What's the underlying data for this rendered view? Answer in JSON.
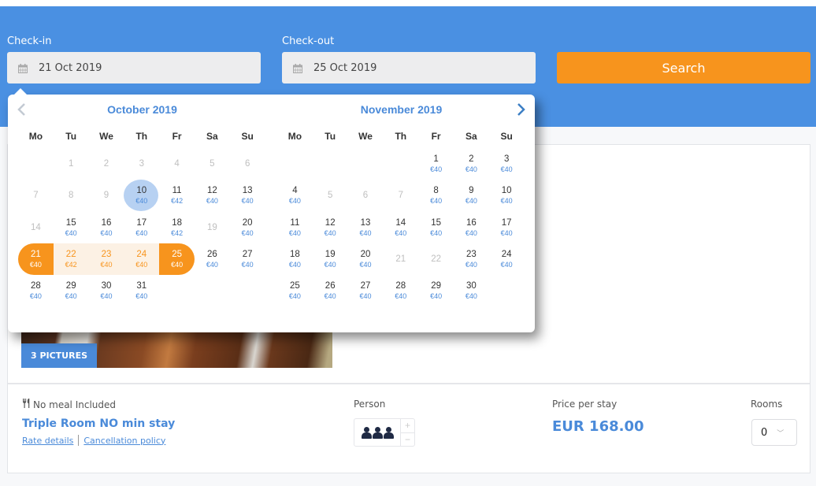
{
  "search": {
    "checkin_label": "Check-in",
    "checkout_label": "Check-out",
    "checkin_value": "21 Oct 2019",
    "checkout_value": "25 Oct 2019",
    "search_label": "Search"
  },
  "datepicker": {
    "prev_icon": "‹",
    "next_icon": "›",
    "weekdays": [
      "Mo",
      "Tu",
      "We",
      "Th",
      "Fr",
      "Sa",
      "Su"
    ],
    "months": [
      {
        "title": "October 2019",
        "offset": 1,
        "days": [
          {
            "d": "1",
            "state": "disabled"
          },
          {
            "d": "2",
            "state": "disabled"
          },
          {
            "d": "3",
            "state": "disabled"
          },
          {
            "d": "4",
            "state": "disabled"
          },
          {
            "d": "5",
            "state": "disabled"
          },
          {
            "d": "6",
            "state": "disabled"
          },
          {
            "d": "7",
            "state": "disabled"
          },
          {
            "d": "8",
            "state": "disabled"
          },
          {
            "d": "9",
            "state": "disabled"
          },
          {
            "d": "10",
            "p": "€40",
            "state": "hover"
          },
          {
            "d": "11",
            "p": "€42"
          },
          {
            "d": "12",
            "p": "€40"
          },
          {
            "d": "13",
            "p": "€40"
          },
          {
            "d": "14",
            "state": "disabled"
          },
          {
            "d": "15",
            "p": "€40"
          },
          {
            "d": "16",
            "p": "€40"
          },
          {
            "d": "17",
            "p": "€40"
          },
          {
            "d": "18",
            "p": "€42"
          },
          {
            "d": "19",
            "state": "disabled"
          },
          {
            "d": "20",
            "p": "€40"
          },
          {
            "d": "21",
            "p": "€40",
            "state": "range-start"
          },
          {
            "d": "22",
            "p": "€42",
            "state": "in-range"
          },
          {
            "d": "23",
            "p": "€40",
            "state": "in-range"
          },
          {
            "d": "24",
            "p": "€40",
            "state": "in-range"
          },
          {
            "d": "25",
            "p": "€40",
            "state": "range-end"
          },
          {
            "d": "26",
            "p": "€40"
          },
          {
            "d": "27",
            "p": "€40"
          },
          {
            "d": "28",
            "p": "€40"
          },
          {
            "d": "29",
            "p": "€40"
          },
          {
            "d": "30",
            "p": "€40"
          },
          {
            "d": "31",
            "p": "€40"
          }
        ]
      },
      {
        "title": "November 2019",
        "offset": 4,
        "days": [
          {
            "d": "1",
            "p": "€40"
          },
          {
            "d": "2",
            "p": "€40"
          },
          {
            "d": "3",
            "p": "€40"
          },
          {
            "d": "4",
            "p": "€40"
          },
          {
            "d": "5",
            "state": "disabled"
          },
          {
            "d": "6",
            "state": "disabled"
          },
          {
            "d": "7",
            "state": "disabled"
          },
          {
            "d": "8",
            "p": "€40"
          },
          {
            "d": "9",
            "p": "€40"
          },
          {
            "d": "10",
            "p": "€40"
          },
          {
            "d": "11",
            "p": "€40"
          },
          {
            "d": "12",
            "p": "€40"
          },
          {
            "d": "13",
            "p": "€40"
          },
          {
            "d": "14",
            "p": "€40"
          },
          {
            "d": "15",
            "p": "€40"
          },
          {
            "d": "16",
            "p": "€40"
          },
          {
            "d": "17",
            "p": "€40"
          },
          {
            "d": "18",
            "p": "€40"
          },
          {
            "d": "19",
            "p": "€40"
          },
          {
            "d": "20",
            "p": "€40"
          },
          {
            "d": "21",
            "state": "disabled"
          },
          {
            "d": "22",
            "state": "disabled"
          },
          {
            "d": "23",
            "p": "€40"
          },
          {
            "d": "24",
            "p": "€40"
          },
          {
            "d": "25",
            "p": "€40"
          },
          {
            "d": "26",
            "p": "€40"
          },
          {
            "d": "27",
            "p": "€40"
          },
          {
            "d": "28",
            "p": "€40"
          },
          {
            "d": "29",
            "p": "€40"
          },
          {
            "d": "30",
            "p": "€40"
          }
        ]
      }
    ]
  },
  "room": {
    "pictures_label": "3 PICTURES",
    "meal_icon": "🍴",
    "meal_label": "No meal Included",
    "name": "Triple Room NO min stay",
    "rate_details_link": "Rate details",
    "cancellation_link": "Cancellation policy",
    "person_label": "Person",
    "person_count": 3,
    "plus": "+",
    "minus": "−",
    "price_label": "Price per stay",
    "price": "EUR 168.00",
    "rooms_label": "Rooms",
    "rooms_value": "0",
    "rooms_chevron": "﹀"
  },
  "colors": {
    "header_blue": "#4a90e2",
    "accent_orange": "#f7941d",
    "link_blue": "#4a8ad9"
  }
}
